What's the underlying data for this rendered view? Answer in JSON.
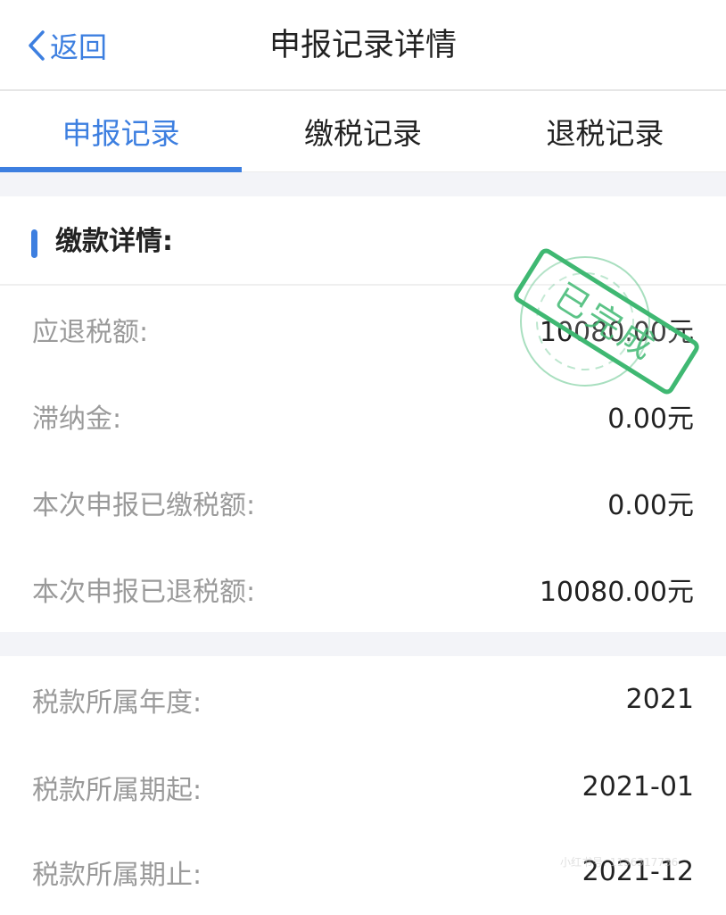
{
  "nav": {
    "back_label": "返回",
    "title": "申报记录详情"
  },
  "tabs": [
    {
      "label": "申报记录",
      "active": true
    },
    {
      "label": "缴税记录",
      "active": false
    },
    {
      "label": "退税记录",
      "active": false
    }
  ],
  "payment_section": {
    "title": "缴款详情:",
    "rows": [
      {
        "label": "应退税额:",
        "value": "10080.00元"
      },
      {
        "label": "滞纳金:",
        "value": "0.00元"
      },
      {
        "label": "本次申报已缴税额:",
        "value": "0.00元"
      },
      {
        "label": "本次申报已退税额:",
        "value": "10080.00元"
      }
    ]
  },
  "period_section": {
    "rows": [
      {
        "label": "税款所属年度:",
        "value": "2021"
      },
      {
        "label": "税款所属期起:",
        "value": "2021-01"
      },
      {
        "label": "税款所属期止:",
        "value": "2021-12"
      }
    ]
  },
  "stamp": {
    "text": "已完成",
    "color": "#3fb872"
  },
  "watermark": {
    "text": "小红书号: 1136317736"
  },
  "colors": {
    "accent": "#3d7fe0",
    "label": "#9a9a9a",
    "value": "#222222",
    "gap": "#f3f4f8"
  }
}
